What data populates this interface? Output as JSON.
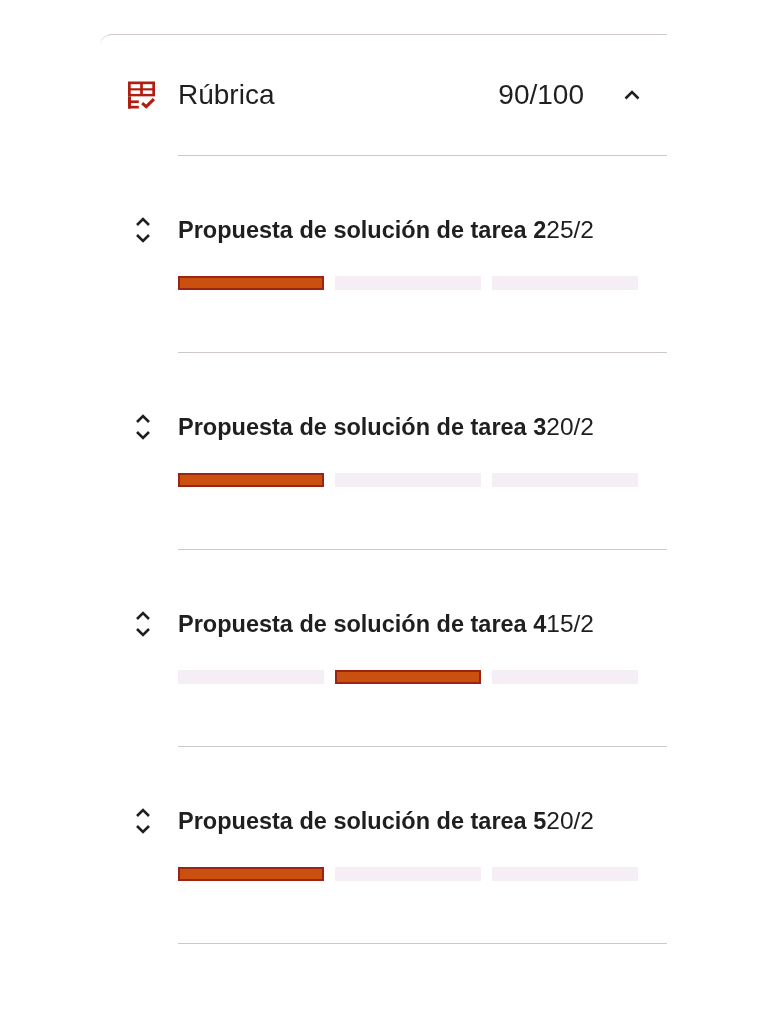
{
  "rubric": {
    "title": "Rúbrica",
    "score": "90/100",
    "expanded": true
  },
  "criteria": [
    {
      "title": "Propuesta de solución de tarea 2",
      "score": "25/2",
      "levels": [
        {
          "selected": true
        },
        {
          "selected": false
        },
        {
          "selected": false
        }
      ]
    },
    {
      "title": "Propuesta de solución de tarea 3",
      "score": "20/2",
      "levels": [
        {
          "selected": true
        },
        {
          "selected": false
        },
        {
          "selected": false
        }
      ]
    },
    {
      "title": "Propuesta de solución de tarea 4",
      "score": "15/2",
      "levels": [
        {
          "selected": false
        },
        {
          "selected": true
        },
        {
          "selected": false
        }
      ]
    },
    {
      "title": "Propuesta de solución de tarea 5",
      "score": "20/2",
      "levels": [
        {
          "selected": true
        },
        {
          "selected": false
        },
        {
          "selected": false
        }
      ]
    }
  ]
}
